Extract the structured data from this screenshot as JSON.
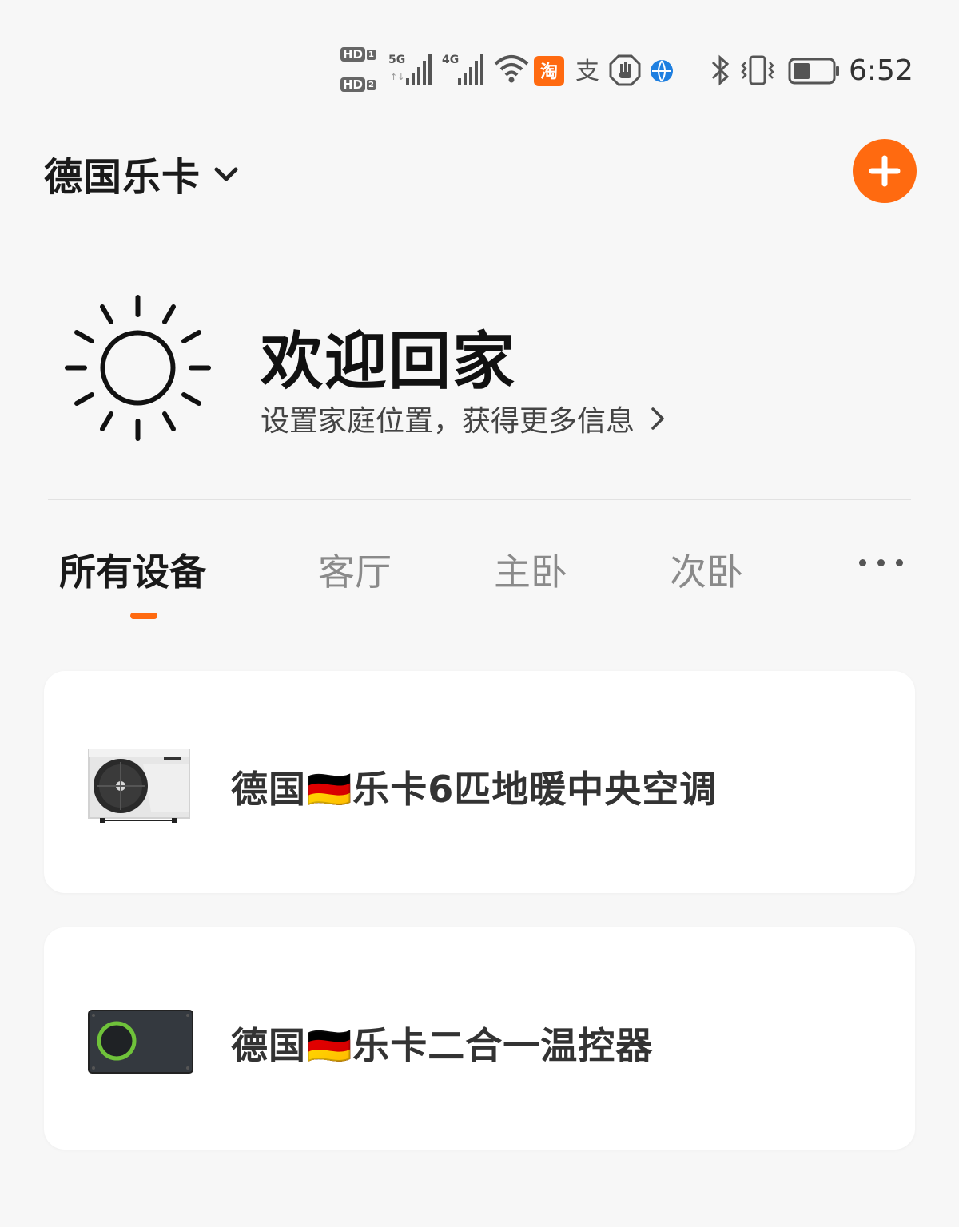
{
  "status_bar": {
    "hd1": "HD",
    "hd1_sub": "1",
    "hd2": "HD",
    "hd2_sub": "2",
    "net1": "5G",
    "net2": "4G",
    "time": "6:52",
    "icons": [
      "signal-5g-icon",
      "signal-4g-icon",
      "wifi-icon",
      "taobao-icon",
      "alipay-icon",
      "hand-icon",
      "browser-icon",
      "bluetooth-icon",
      "vibrate-icon",
      "battery-icon"
    ]
  },
  "header": {
    "home_name": "德国乐卡",
    "add_icon": "plus-icon"
  },
  "welcome": {
    "title": "欢迎回家",
    "subtitle": "设置家庭位置，获得更多信息"
  },
  "tabs": [
    {
      "label": "所有设备",
      "active": true
    },
    {
      "label": "客厅",
      "active": false
    },
    {
      "label": "主卧",
      "active": false
    },
    {
      "label": "次卧",
      "active": false
    }
  ],
  "devices": [
    {
      "name": "德国🇩🇪乐卡6匹地暖中央空调",
      "icon": "heat-pump-unit-icon"
    },
    {
      "name": "德国🇩🇪乐卡二合一温控器",
      "icon": "thermostat-icon"
    }
  ],
  "colors": {
    "accent": "#ff6a10",
    "background": "#f7f7f7",
    "card": "#ffffff"
  }
}
